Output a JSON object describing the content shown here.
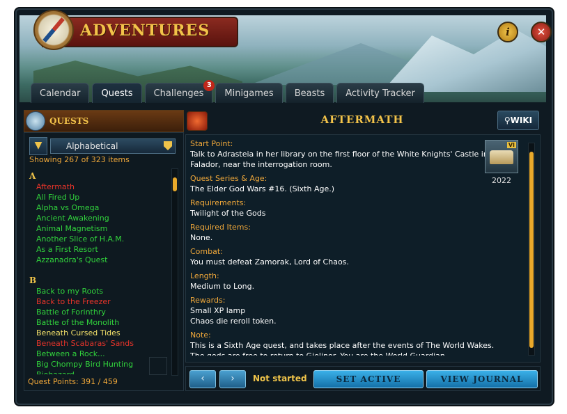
{
  "window": {
    "title": "ADVENTURES"
  },
  "icons": {
    "compass": "compass-icon",
    "info": "info-icon",
    "close": "close-icon",
    "filter": "filter-icon",
    "wiki": "magnifier-icon"
  },
  "header": {
    "info_label": "i",
    "close_label": "✕"
  },
  "tabs": [
    {
      "label": "Calendar"
    },
    {
      "label": "Quests",
      "active": true
    },
    {
      "label": "Challenges",
      "badge": "3"
    },
    {
      "label": "Minigames"
    },
    {
      "label": "Beasts"
    },
    {
      "label": "Activity Tracker"
    }
  ],
  "left_panel": {
    "heading": "QUESTS",
    "sort_value": "Alphabetical",
    "showing": "Showing 267 of 323 items",
    "sections": [
      {
        "letter": "A",
        "items": [
          {
            "name": "Aftermath",
            "status": "red"
          },
          {
            "name": "All Fired Up",
            "status": "green"
          },
          {
            "name": "Alpha vs Omega",
            "status": "green"
          },
          {
            "name": "Ancient Awakening",
            "status": "green"
          },
          {
            "name": "Animal Magnetism",
            "status": "green"
          },
          {
            "name": "Another Slice of H.A.M.",
            "status": "green"
          },
          {
            "name": "As a First Resort",
            "status": "green"
          },
          {
            "name": "Azzanadra's Quest",
            "status": "green"
          }
        ]
      },
      {
        "letter": "B",
        "items": [
          {
            "name": "Back to my Roots",
            "status": "green"
          },
          {
            "name": "Back to the Freezer",
            "status": "red"
          },
          {
            "name": "Battle of Forinthry",
            "status": "green"
          },
          {
            "name": "Battle of the Monolith",
            "status": "green"
          },
          {
            "name": "Beneath Cursed Tides",
            "status": "yellow"
          },
          {
            "name": "Beneath Scabaras' Sands",
            "status": "red"
          },
          {
            "name": "Between a Rock...",
            "status": "green"
          },
          {
            "name": "Big Chompy Bird Hunting",
            "status": "green"
          },
          {
            "name": "Biohazard",
            "status": "green"
          }
        ]
      }
    ],
    "quest_points": "Quest Points: 391 / 459"
  },
  "quest": {
    "title": "AFTERMATH",
    "wiki_label": "WIKI",
    "year": "2022",
    "age_badge": "VI",
    "details": [
      {
        "label": "Start Point:",
        "value": "Talk to Adrasteia in her library on the first floor of the White Knights' Castle in Falador, near the interrogation room."
      },
      {
        "label": "Quest Series & Age:",
        "value": "The Elder God Wars #16. (Sixth Age.)"
      },
      {
        "label": "Requirements:",
        "value": "Twilight of the Gods"
      },
      {
        "label": "Required Items:",
        "value": "None."
      },
      {
        "label": "Combat:",
        "value": "You must defeat Zamorak, Lord of Chaos."
      },
      {
        "label": "Length:",
        "value": "Medium to Long."
      },
      {
        "label": "Rewards:",
        "value": "Small XP lamp\nChaos die reroll token."
      },
      {
        "label": "Note:",
        "value": "This is a Sixth Age quest, and takes place after the events of The World Wakes. The gods are free to return to Gielinor. You are the World Guardian."
      }
    ]
  },
  "footer": {
    "prev_label": "‹",
    "next_label": "›",
    "status": "Not started",
    "set_active": "SET ACTIVE",
    "view_journal": "VIEW JOURNAL"
  },
  "colors": {
    "accent": "#f3c34a",
    "complete": "#31d33c",
    "not_started": "#e8342a",
    "in_progress": "#f5e26a",
    "button": "#2a9ad6"
  }
}
